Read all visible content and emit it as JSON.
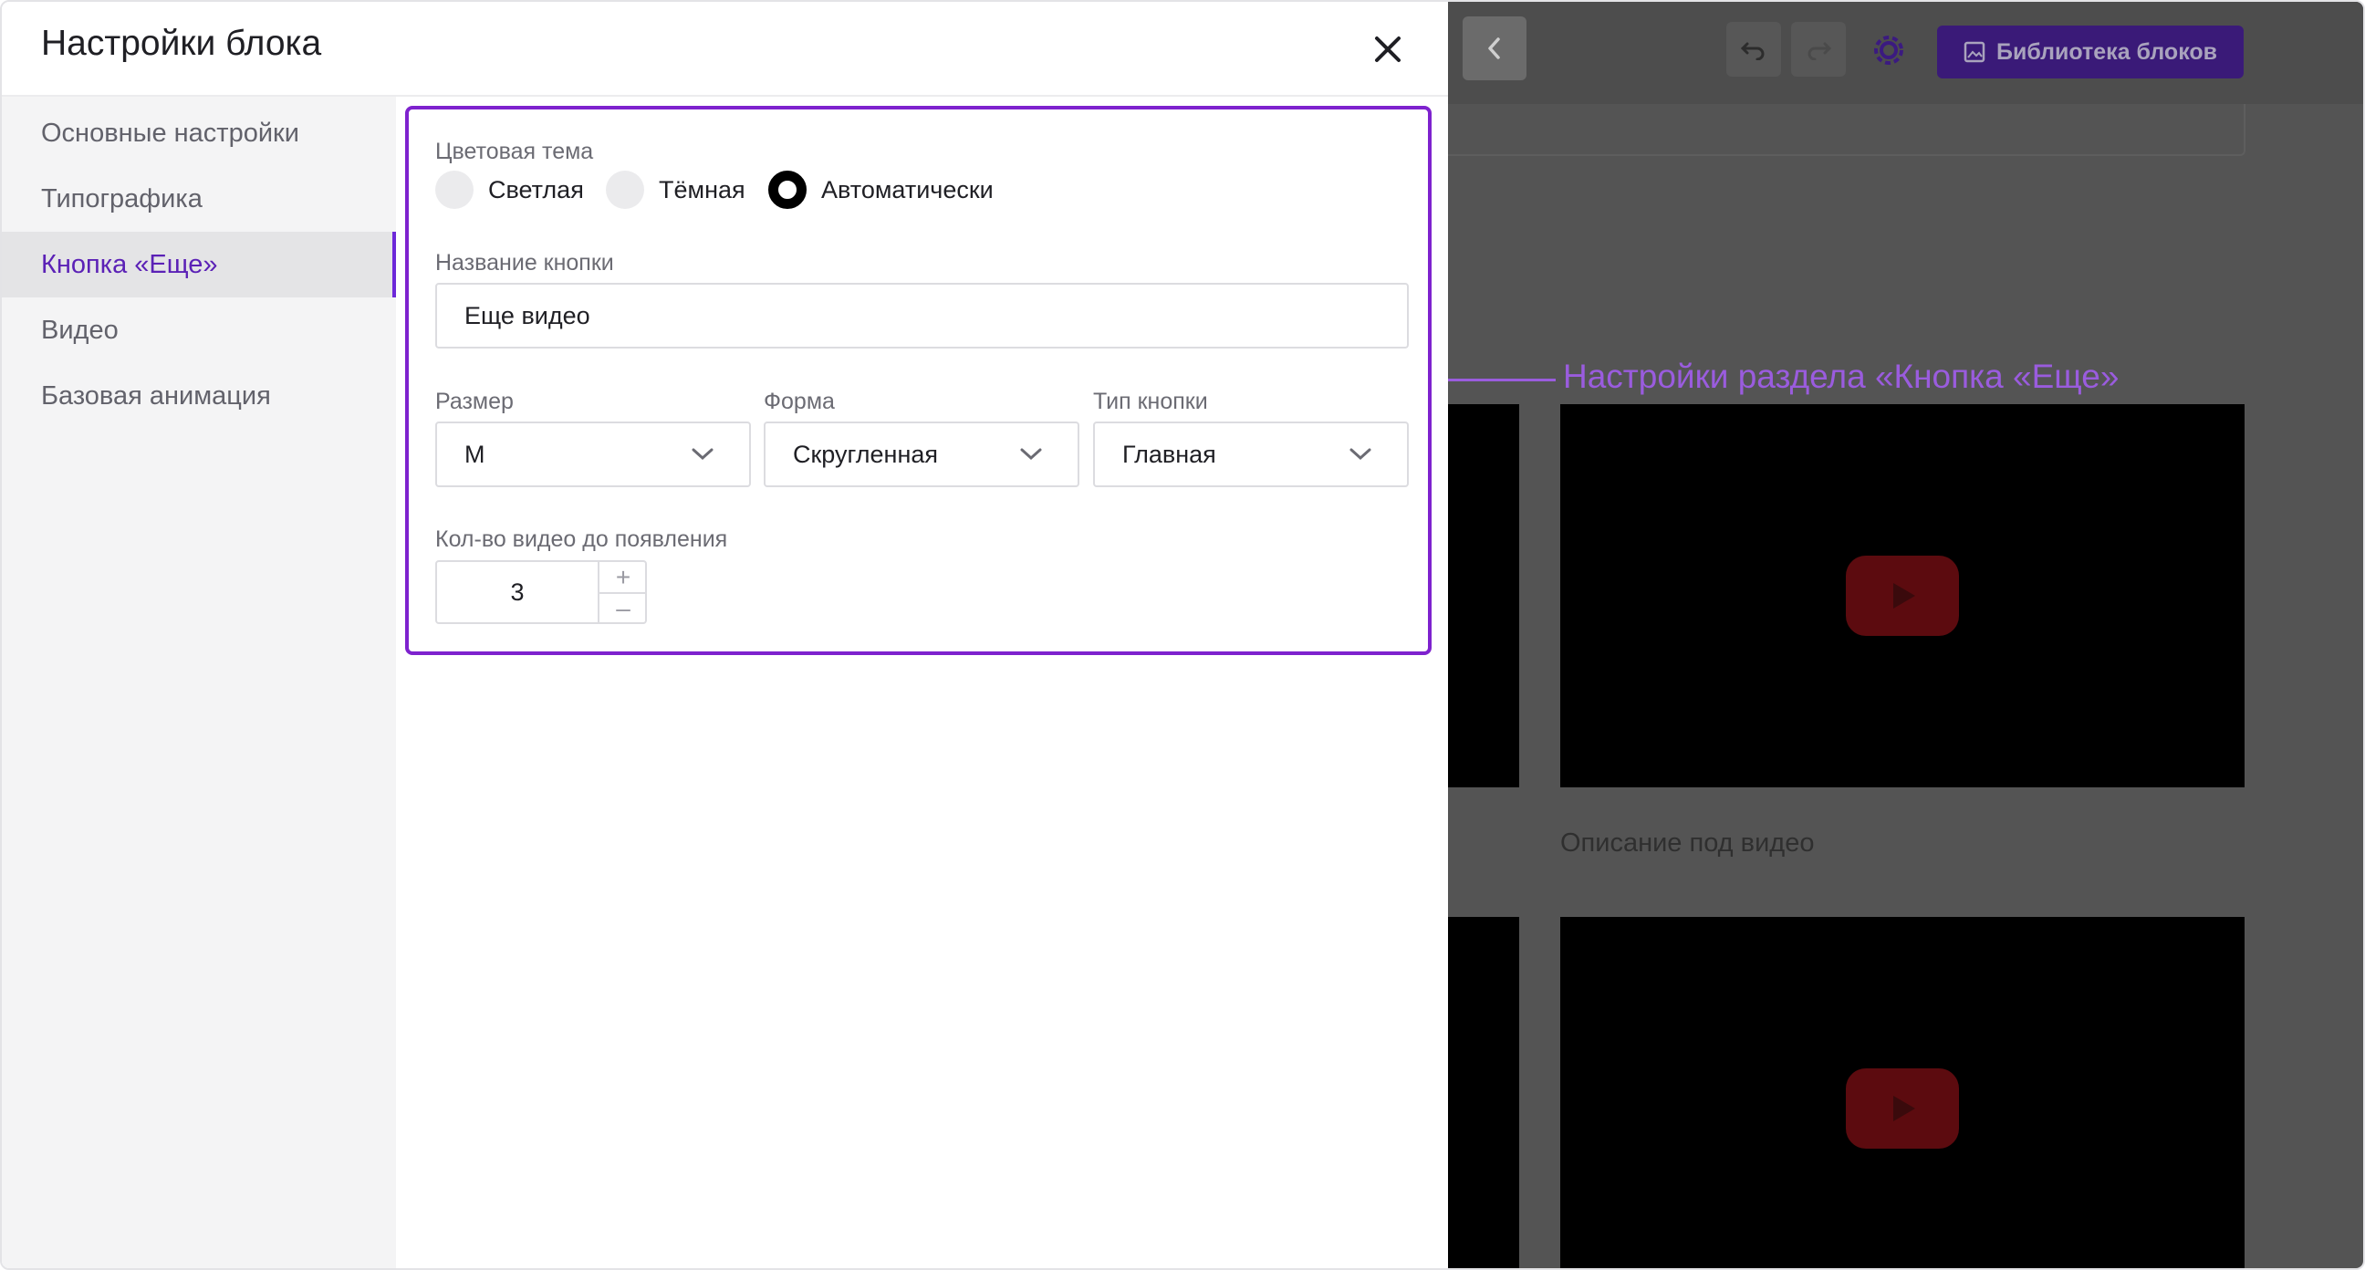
{
  "editor": {
    "library_button_label": "Библиотека блоков",
    "video_caption": "Описание под видео",
    "icons": {
      "back": "chevron-left-icon",
      "undo": "undo-icon",
      "redo": "redo-icon",
      "settings": "gear-icon",
      "library": "image-icon",
      "play": "youtube-play-icon"
    }
  },
  "annotation": {
    "text": "Настройки раздела «Кнопка «Еще»",
    "color": "#9a5cde"
  },
  "panel": {
    "title": "Настройки блока",
    "close_icon": "close-icon"
  },
  "sidebar": {
    "items": [
      {
        "label": "Основные настройки",
        "active": false
      },
      {
        "label": "Типографика",
        "active": false
      },
      {
        "label": "Кнопка «Еще»",
        "active": true
      },
      {
        "label": "Видео",
        "active": false
      },
      {
        "label": "Базовая анимация",
        "active": false
      }
    ]
  },
  "form": {
    "color_theme": {
      "label": "Цветовая тема",
      "options": [
        "Светлая",
        "Тёмная",
        "Автоматически"
      ],
      "selected": "Автоматически"
    },
    "button_name": {
      "label": "Название кнопки",
      "value": "Еще видео"
    },
    "size": {
      "label": "Размер",
      "value": "M"
    },
    "shape": {
      "label": "Форма",
      "value": "Скругленная"
    },
    "button_type": {
      "label": "Тип кнопки",
      "value": "Главная"
    },
    "videos_before": {
      "label": "Кол-во видео до появления",
      "value": "3",
      "increment": "+",
      "decrement": "–"
    }
  },
  "colors": {
    "accent": "#7e22ce",
    "active_item_text": "#5b21b6"
  }
}
